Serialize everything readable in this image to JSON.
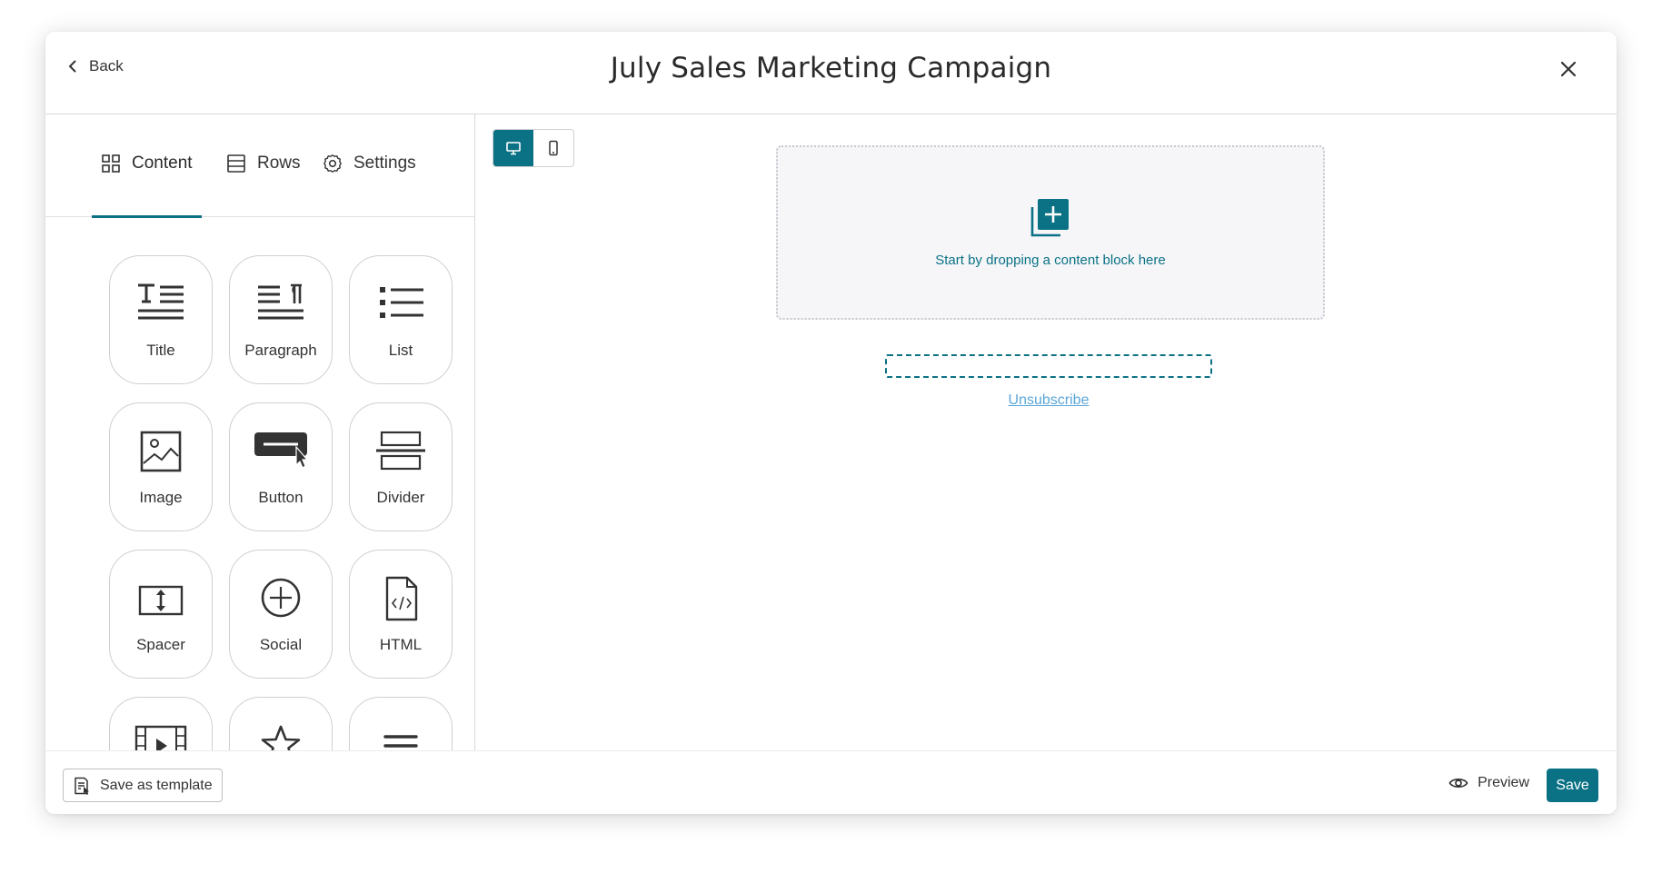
{
  "header": {
    "back_label": "Back",
    "title": "July Sales Marketing Campaign"
  },
  "tabs": [
    {
      "label": "Content",
      "icon": "grid-icon",
      "active": true
    },
    {
      "label": "Rows",
      "icon": "rows-icon"
    },
    {
      "label": "Settings",
      "icon": "gear-icon"
    }
  ],
  "blocks": [
    {
      "label": "Title",
      "icon": "title-icon"
    },
    {
      "label": "Paragraph",
      "icon": "paragraph-icon"
    },
    {
      "label": "List",
      "icon": "list-icon"
    },
    {
      "label": "Image",
      "icon": "image-icon"
    },
    {
      "label": "Button",
      "icon": "button-icon"
    },
    {
      "label": "Divider",
      "icon": "divider-icon"
    },
    {
      "label": "Spacer",
      "icon": "spacer-icon"
    },
    {
      "label": "Social",
      "icon": "social-icon"
    },
    {
      "label": "HTML",
      "icon": "html-icon"
    },
    {
      "label": "",
      "icon": "video-icon"
    },
    {
      "label": "",
      "icon": "star-icon"
    },
    {
      "label": "",
      "icon": "menu-icon"
    }
  ],
  "canvas": {
    "device_modes": [
      "desktop",
      "mobile"
    ],
    "active_device": "desktop",
    "dropzone_text": "Start by dropping a content block here",
    "unsubscribe_label": "Unsubscribe"
  },
  "footer": {
    "save_template_label": "Save as template",
    "preview_label": "Preview",
    "save_label": "Save"
  },
  "colors": {
    "accent": "#0b7285",
    "link": "#5aa6d8",
    "border": "#d8d8d8"
  }
}
